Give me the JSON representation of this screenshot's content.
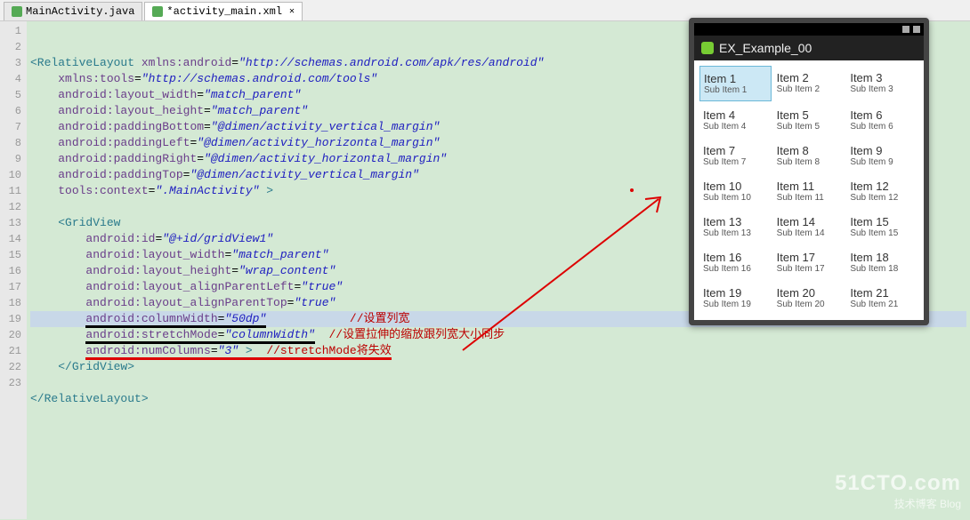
{
  "tabs": [
    {
      "label": "MainActivity.java",
      "active": false
    },
    {
      "label": "*activity_main.xml",
      "active": true
    }
  ],
  "code": {
    "lines": [
      {
        "n": 1,
        "html": "<span class='tag'>&lt;RelativeLayout</span> <span class='attr'>xmlns:android</span>=<span class='val'>\"http://schemas.android.com/apk/res/android\"</span>"
      },
      {
        "n": 2,
        "html": "    <span class='attr'>xmlns:tools</span>=<span class='val'>\"http://schemas.android.com/tools\"</span>"
      },
      {
        "n": 3,
        "html": "    <span class='attr'>android:layout_width</span>=<span class='val'>\"match_parent\"</span>"
      },
      {
        "n": 4,
        "html": "    <span class='attr'>android:layout_height</span>=<span class='val'>\"match_parent\"</span>"
      },
      {
        "n": 5,
        "html": "    <span class='attr'>android:paddingBottom</span>=<span class='val'>\"@dimen/activity_vertical_margin\"</span>"
      },
      {
        "n": 6,
        "html": "    <span class='attr'>android:paddingLeft</span>=<span class='val'>\"@dimen/activity_horizontal_margin\"</span>"
      },
      {
        "n": 7,
        "html": "    <span class='attr'>android:paddingRight</span>=<span class='val'>\"@dimen/activity_horizontal_margin\"</span>"
      },
      {
        "n": 8,
        "html": "    <span class='attr'>android:paddingTop</span>=<span class='val'>\"@dimen/activity_vertical_margin\"</span>"
      },
      {
        "n": 9,
        "html": "    <span class='attr'>tools:context</span>=<span class='val'>\".MainActivity\"</span> <span class='tag'>&gt;</span>"
      },
      {
        "n": 10,
        "html": ""
      },
      {
        "n": 11,
        "html": "    <span class='tag'>&lt;GridView</span>"
      },
      {
        "n": 12,
        "html": "        <span class='attr'>android:id</span>=<span class='val'>\"@+id/gridView1\"</span>"
      },
      {
        "n": 13,
        "html": "        <span class='attr'>android:layout_width</span>=<span class='val'>\"match_parent\"</span>"
      },
      {
        "n": 14,
        "html": "        <span class='attr'>android:layout_height</span>=<span class='val'>\"wrap_content\"</span>"
      },
      {
        "n": 15,
        "html": "        <span class='attr'>android:layout_alignParentLeft</span>=<span class='val'>\"true\"</span>"
      },
      {
        "n": 16,
        "html": "        <span class='attr'>android:layout_alignParentTop</span>=<span class='val'>\"true\"</span>"
      },
      {
        "n": 17,
        "html": "        <span class='underline-black'><span class='attr'>android:columnWidth</span>=<span class='val'>\"50dp\"</span></span>            <span class='cmt'>//设置列宽</span>",
        "highlight": true
      },
      {
        "n": 18,
        "html": "        <span class='underline-black'><span class='attr'>android:stretchMode</span>=<span class='val'>\"columnWidth\"</span></span>  <span class='cmt'>//设置拉伸的缩放跟列宽大小同步</span>"
      },
      {
        "n": 19,
        "html": "        <span class='underline-red'><span class='attr'>android:numColumns</span>=<span class='val'>\"3\"</span> <span class='tag'>&gt;</span>  <span class='cmt'>//stretchMode将失效</span></span>"
      },
      {
        "n": 20,
        "html": "    <span class='tag'>&lt;/GridView&gt;</span>"
      },
      {
        "n": 21,
        "html": ""
      },
      {
        "n": 22,
        "html": "<span class='tag'>&lt;/RelativeLayout&gt;</span>"
      },
      {
        "n": 23,
        "html": ""
      }
    ]
  },
  "device": {
    "appTitle": "EX_Example_00",
    "items": [
      {
        "title": "Item 1",
        "sub": "Sub Item 1",
        "selected": true
      },
      {
        "title": "Item 2",
        "sub": "Sub Item 2"
      },
      {
        "title": "Item 3",
        "sub": "Sub Item 3"
      },
      {
        "title": "Item 4",
        "sub": "Sub Item 4"
      },
      {
        "title": "Item 5",
        "sub": "Sub Item 5"
      },
      {
        "title": "Item 6",
        "sub": "Sub Item 6"
      },
      {
        "title": "Item 7",
        "sub": "Sub Item 7"
      },
      {
        "title": "Item 8",
        "sub": "Sub Item 8"
      },
      {
        "title": "Item 9",
        "sub": "Sub Item 9"
      },
      {
        "title": "Item 10",
        "sub": "Sub Item 10"
      },
      {
        "title": "Item 11",
        "sub": "Sub Item 11"
      },
      {
        "title": "Item 12",
        "sub": "Sub Item 12"
      },
      {
        "title": "Item 13",
        "sub": "Sub Item 13"
      },
      {
        "title": "Item 14",
        "sub": "Sub Item 14"
      },
      {
        "title": "Item 15",
        "sub": "Sub Item 15"
      },
      {
        "title": "Item 16",
        "sub": "Sub Item 16"
      },
      {
        "title": "Item 17",
        "sub": "Sub Item 17"
      },
      {
        "title": "Item 18",
        "sub": "Sub Item 18"
      },
      {
        "title": "Item 19",
        "sub": "Sub Item 19"
      },
      {
        "title": "Item 20",
        "sub": "Sub Item 20"
      },
      {
        "title": "Item 21",
        "sub": "Sub Item 21"
      }
    ]
  },
  "watermark": {
    "big": "51CTO.com",
    "small": "技术博客    Blog"
  }
}
